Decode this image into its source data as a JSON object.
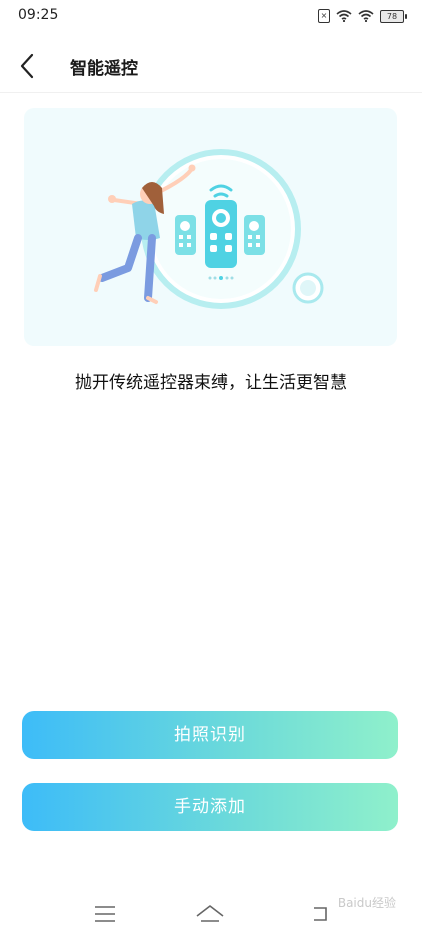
{
  "status_bar": {
    "time": "09:25",
    "battery_level": "78"
  },
  "header": {
    "title": "智能遥控"
  },
  "main": {
    "tagline": "抛开传统遥控器束缚，让生活更智慧"
  },
  "actions": {
    "photo_recognize": "拍照识别",
    "manual_add": "手动添加"
  },
  "colors": {
    "button_gradient_start": "#3dbcf8",
    "button_gradient_end": "#8ff0cb",
    "illustration_bg": "#f0fbfd"
  },
  "nav": {
    "menu_icon": "menu-icon",
    "home_icon": "home-icon",
    "back_icon": "back-icon"
  },
  "watermark": "Baidu经验"
}
